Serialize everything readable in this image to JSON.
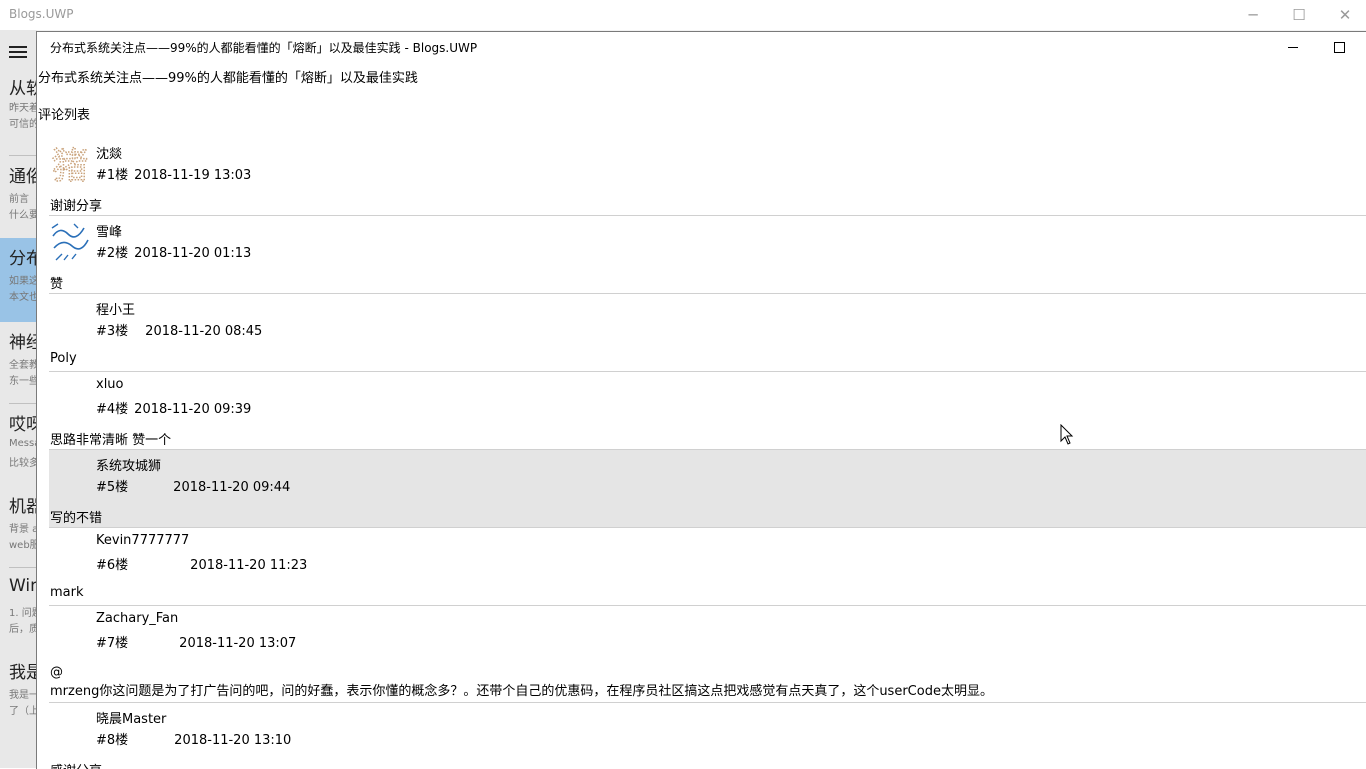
{
  "app": {
    "title": "Blogs.UWP",
    "controls": {
      "minimize": "─",
      "maximize": "☐",
      "close": "✕"
    }
  },
  "sidebar": {
    "items": [
      {
        "title": "从软",
        "line1": "昨天着",
        "line2": "可信的",
        "selected": false
      },
      {
        "title": "通俗",
        "line1": "前言（",
        "line2": "什么要",
        "selected": false
      },
      {
        "title": "分布",
        "line1": "如果这",
        "line2": "本文也",
        "selected": true
      },
      {
        "title": "神经",
        "line1": "全套教",
        "line2": "东一些",
        "selected": false
      },
      {
        "title": "哎呀",
        "line1": "Messa",
        "line2": "比较多",
        "selected": false
      },
      {
        "title": "机器",
        "line1": "背景 a",
        "line2": "web服",
        "selected": false
      },
      {
        "title": "Win",
        "line1": "1. 问题",
        "line2": "后，质",
        "selected": false
      },
      {
        "title": "我是",
        "line1": "我是一",
        "line2": "了（上",
        "selected": false
      }
    ]
  },
  "dialog": {
    "title": "分布式系统关注点——99%的人都能看懂的「熔断」以及最佳实践 - Blogs.UWP",
    "post_title": "分布式系统关注点——99%的人都能看懂的「熔断」以及最佳实践",
    "comments_heading": "评论列表",
    "comments": [
      {
        "author": "沈燚",
        "floor": "#1楼",
        "time": "2018-11-19 13:03",
        "body": "谢谢分享",
        "avatar": "pig-glyph-avatar"
      },
      {
        "author": "雪峰",
        "floor": "#2楼",
        "time": "2018-11-20 01:13",
        "body": "赞",
        "avatar": "wave-line-avatar"
      },
      {
        "author": "程小王",
        "floor": "#3楼",
        "time": "2018-11-20 08:45",
        "body": "Poly",
        "avatar": ""
      },
      {
        "author": "xluo",
        "floor": "#4楼",
        "time": "2018-11-20 09:39",
        "body": "思路非常清晰 赞一个",
        "avatar": ""
      },
      {
        "author": "系统攻城狮",
        "floor": "#5楼",
        "time": "2018-11-20 09:44",
        "body": "写的不错",
        "avatar": ""
      },
      {
        "author": "Kevin7777777",
        "floor": "#6楼",
        "time": "2018-11-20 11:23",
        "body": "mark",
        "avatar": ""
      },
      {
        "author": "Zachary_Fan",
        "floor": "#7楼",
        "time": "2018-11-20 13:07",
        "body_line1": "@",
        "body_line2": "mrzeng你这问题是为了打广告问的吧，问的好蠢，表示你懂的概念多？。还带个自己的优惠码，在程序员社区搞这点把戏感觉有点天真了，这个userCode太明显。",
        "avatar": ""
      },
      {
        "author": "晓晨Master",
        "floor": "#8楼",
        "time": "2018-11-20 13:10",
        "body": "感谢分享",
        "avatar": ""
      }
    ]
  },
  "colors": {
    "selection": "#99c3e6",
    "hover_row": "#e5e5e5",
    "divider": "#d0d0d0"
  }
}
